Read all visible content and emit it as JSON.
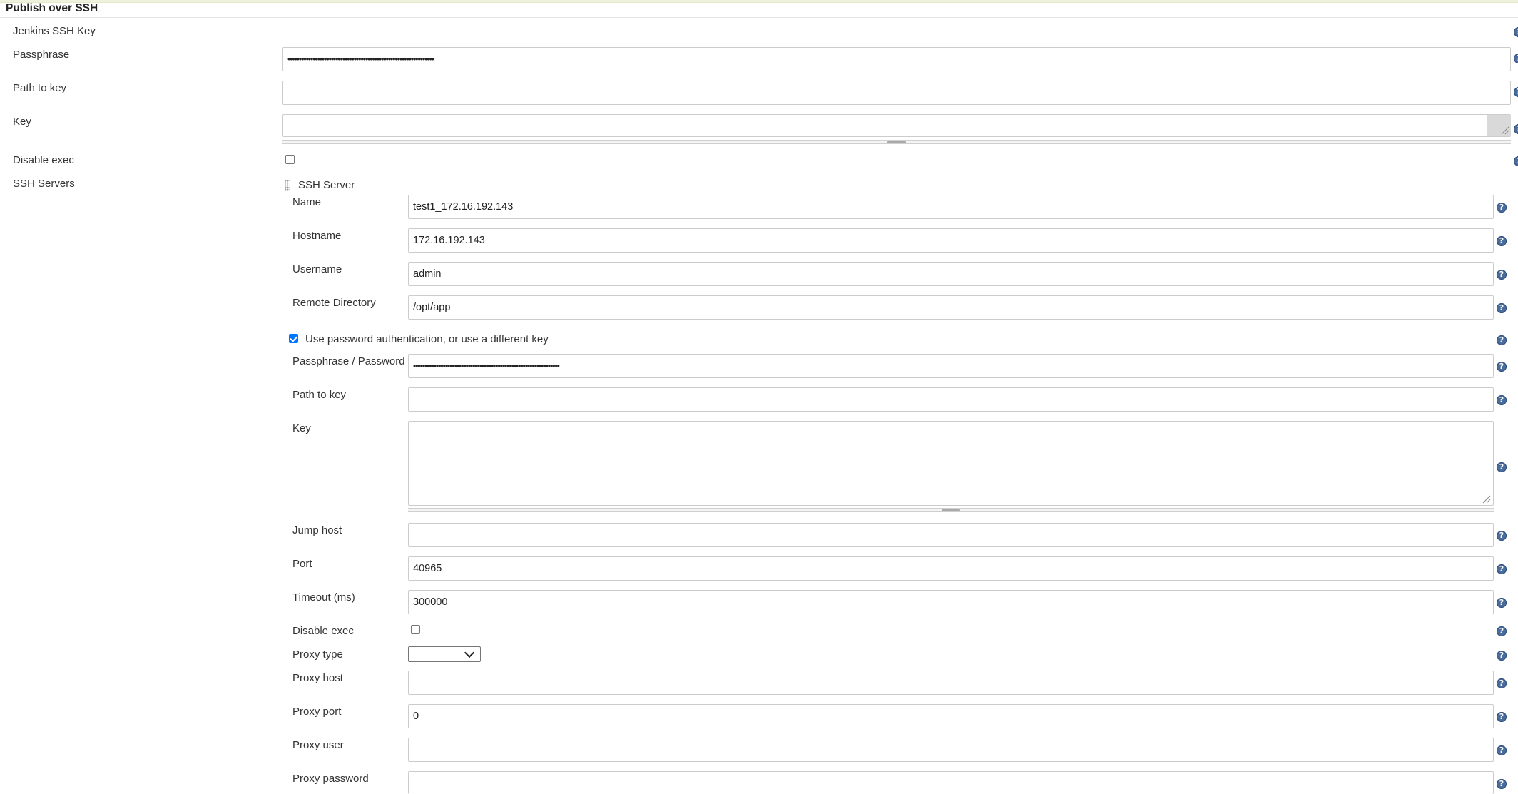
{
  "section": {
    "title": "Publish over SSH"
  },
  "global": {
    "jenkins_ssh_key_label": "Jenkins SSH Key",
    "passphrase_label": "Passphrase",
    "passphrase_value": "••••••••••••••••••••••••••••••••••••••••••••••••••••••••••••••••",
    "path_to_key_label": "Path to key",
    "path_to_key_value": "",
    "key_label": "Key",
    "key_value": "",
    "disable_exec_label": "Disable exec",
    "disable_exec_checked": false,
    "ssh_servers_label": "SSH Servers"
  },
  "server": {
    "header": "SSH Server",
    "name_label": "Name",
    "name_value": "test1_172.16.192.143",
    "hostname_label": "Hostname",
    "hostname_value": "172.16.192.143",
    "username_label": "Username",
    "username_value": "admin",
    "remote_dir_label": "Remote Directory",
    "remote_dir_value": "/opt/app",
    "use_password_label": "Use password authentication, or use a different key",
    "use_password_checked": true,
    "passphrase_label": "Passphrase / Password",
    "passphrase_value": "••••••••••••••••••••••••••••••••••••••••••••••••••••••••••••••••",
    "path_to_key_label": "Path to key",
    "path_to_key_value": "",
    "key_label": "Key",
    "key_value": "",
    "jump_host_label": "Jump host",
    "jump_host_value": "",
    "port_label": "Port",
    "port_value": "40965",
    "timeout_label": "Timeout (ms)",
    "timeout_value": "300000",
    "disable_exec_label": "Disable exec",
    "disable_exec_checked": false,
    "proxy_type_label": "Proxy type",
    "proxy_type_value": "",
    "proxy_host_label": "Proxy host",
    "proxy_host_value": "",
    "proxy_port_label": "Proxy port",
    "proxy_port_value": "0",
    "proxy_user_label": "Proxy user",
    "proxy_user_value": "",
    "proxy_password_label": "Proxy password",
    "proxy_password_value": ""
  },
  "icons": {
    "help": "help-icon",
    "drag": "drag-handle-icon",
    "dropdown": "chevron-down-icon"
  },
  "colors": {
    "help_icon": "#4a6c9b",
    "checkbox_checked": "#0075ff",
    "field_border": "#cccccc"
  }
}
